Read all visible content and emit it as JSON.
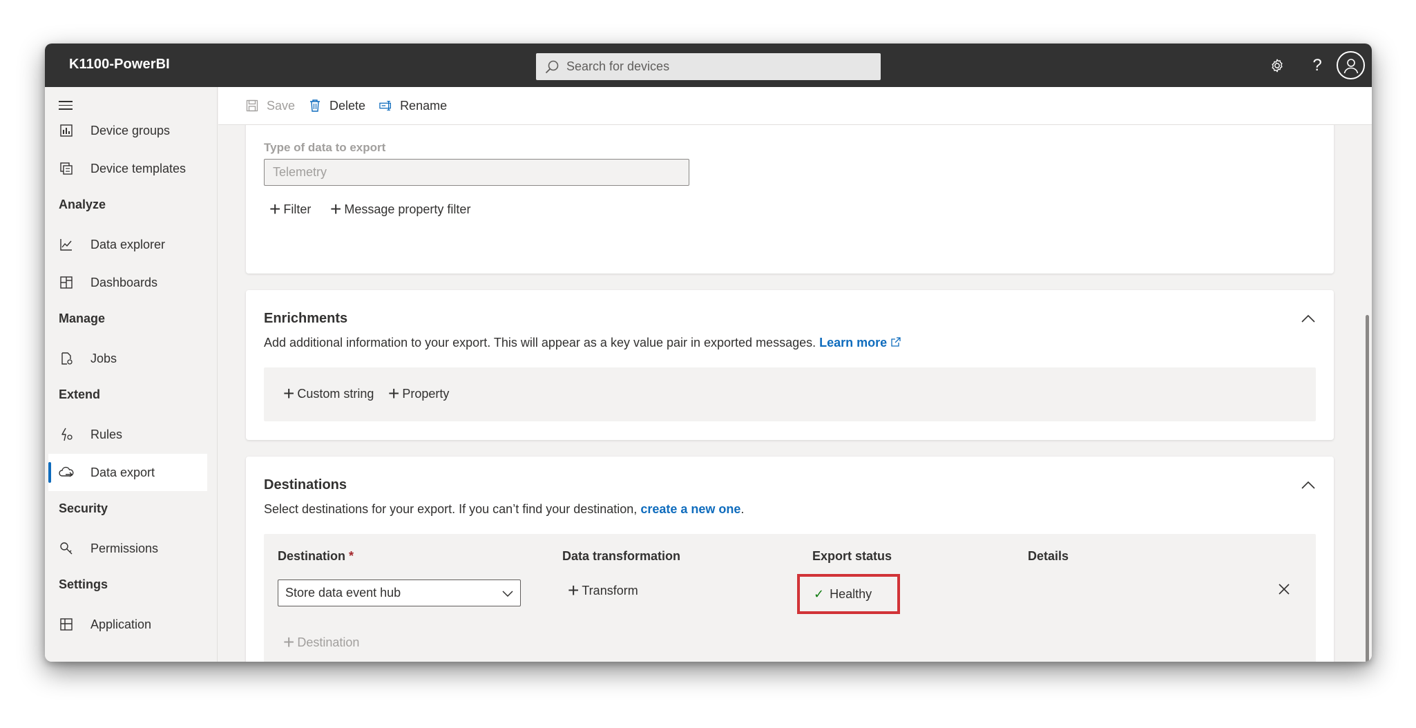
{
  "app": {
    "title": "K1100-PowerBI"
  },
  "search": {
    "placeholder": "Search for devices",
    "icon": "search-icon"
  },
  "header_icons": {
    "settings": "gear-icon",
    "help": "?",
    "profile": "person-icon"
  },
  "sidebar": {
    "items": [
      {
        "label": "Device groups",
        "icon": "device-groups-icon"
      },
      {
        "label": "Device templates",
        "icon": "device-templates-icon"
      },
      {
        "label": "Data explorer",
        "icon": "chart-icon"
      },
      {
        "label": "Dashboards",
        "icon": "dashboard-icon"
      },
      {
        "label": "Jobs",
        "icon": "jobs-icon"
      },
      {
        "label": "Rules",
        "icon": "rules-icon"
      },
      {
        "label": "Data export",
        "icon": "cloud-export-icon",
        "active": true
      },
      {
        "label": "Permissions",
        "icon": "key-icon"
      },
      {
        "label": "Application",
        "icon": "application-icon"
      }
    ],
    "sections": {
      "analyze": "Analyze",
      "manage": "Manage",
      "extend": "Extend",
      "security": "Security",
      "settings": "Settings"
    }
  },
  "toolbar": {
    "save": "Save",
    "delete": "Delete",
    "rename": "Rename"
  },
  "data_type": {
    "label": "Type of data to export",
    "value": "Telemetry",
    "filter": "Filter",
    "message_property_filter": "Message property filter"
  },
  "enrichments": {
    "title": "Enrichments",
    "description": "Add additional information to your export. This will appear as a key value pair in exported messages.",
    "learn_more": "Learn more",
    "custom_string": "Custom string",
    "property": "Property"
  },
  "destinations": {
    "title": "Destinations",
    "description": "Select destinations for your export. If you can’t find your destination,",
    "create_link": "create a new one",
    "period": ".",
    "columns": {
      "destination": "Destination",
      "required_mark": "*",
      "data_transformation": "Data transformation",
      "export_status": "Export status",
      "details": "Details"
    },
    "row": {
      "destination": "Store data event hub",
      "transform": "Transform",
      "status": "Healthy"
    },
    "add_destination": "Destination"
  },
  "colors": {
    "accent": "#0f6cbd",
    "topbar": "#323232",
    "healthy": "#107c10",
    "highlight": "#d13438"
  }
}
